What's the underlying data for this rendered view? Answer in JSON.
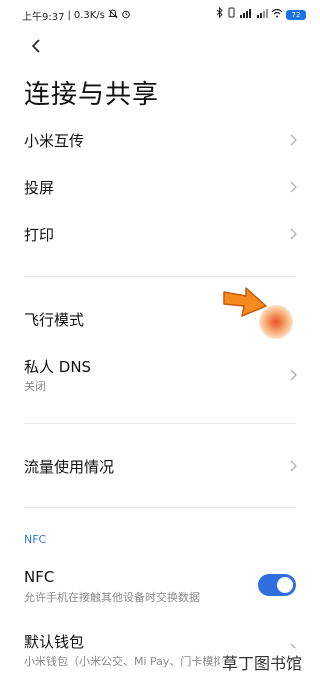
{
  "status_bar": {
    "time": "上午9:37",
    "speed": "0.3K/s",
    "battery": "72"
  },
  "header": {
    "title": "连接与共享"
  },
  "items": [
    {
      "label": "小米互传"
    },
    {
      "label": "投屏"
    },
    {
      "label": "打印"
    },
    {
      "label": "飞行模式"
    },
    {
      "label": "私人 DNS",
      "sub": "关闭"
    },
    {
      "label": "流量使用情况"
    }
  ],
  "nfc_section": {
    "header": "NFC",
    "nfc_label": "NFC",
    "nfc_sub": "允许手机在接触其他设备时交换数据",
    "nfc_enabled": true,
    "wallet_label": "默认钱包",
    "wallet_sub": "小米钱包（小米公交、Mi Pay、门卡模拟"
  },
  "watermark": {
    "text": "草丁图书馆",
    "accent": "#e8581c"
  },
  "colors": {
    "accent": "#2f6fe0",
    "section_header": "#3a7bd5",
    "pointer": "#f58a1f"
  }
}
